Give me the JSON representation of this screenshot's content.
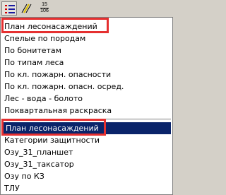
{
  "toolbar": {
    "buttons": [
      {
        "icon": "legend-list-icon"
      },
      {
        "icon": "hatch-lines-icon"
      }
    ],
    "fraction_top": "15",
    "fraction_bottom": "106"
  },
  "menu": {
    "group1": [
      "План лесонасаждений",
      "Спелые по породам",
      "По бонитетам",
      "По типам леса",
      "По кл. пожарн. опасности",
      "По кл. пожарн. опасн. осред.",
      "Лес - вода - болото",
      "Поквартальная раскраска"
    ],
    "group2": [
      "План лесонасаждений",
      "Категории защитности",
      "Озу_31_планшет",
      "Озу_31_таксатор",
      "Озу по КЗ",
      "ТЛУ"
    ],
    "selected_item": "План лесонасаждений"
  },
  "colors": {
    "selection": "#0a246a",
    "annotation_box": "#e53030"
  }
}
